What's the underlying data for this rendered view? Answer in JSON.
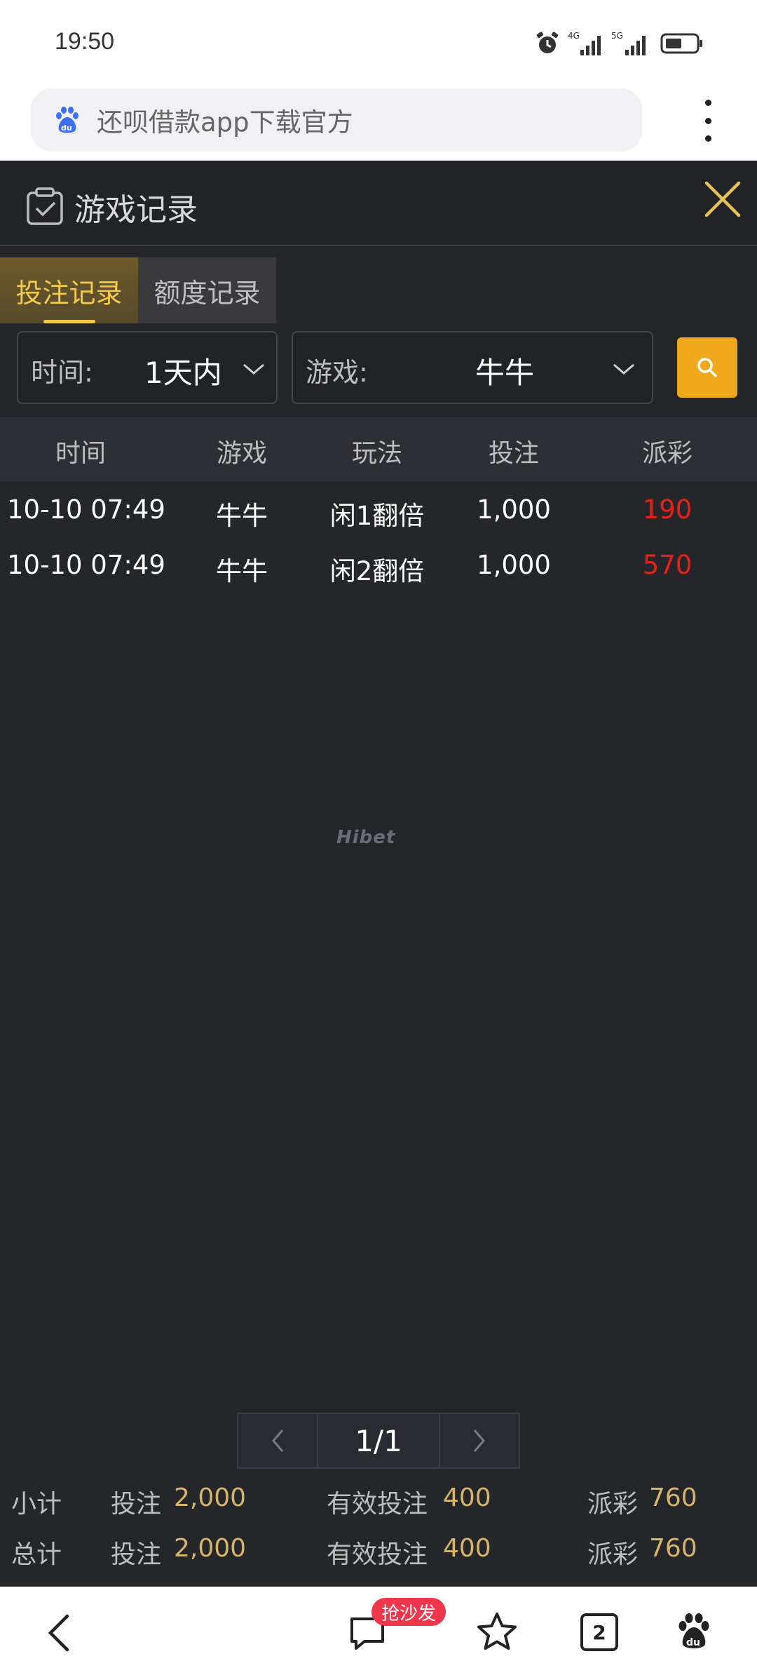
{
  "status_bar": {
    "time": "19:50",
    "net1": "4G",
    "net2": "5G"
  },
  "browser": {
    "url_text": "还呗借款app下载官方",
    "tab_count": "2",
    "sofa_badge": "抢沙发"
  },
  "dialog": {
    "title": "游戏记录"
  },
  "tabs": [
    {
      "label": "投注记录",
      "active": true
    },
    {
      "label": "额度记录",
      "active": false
    }
  ],
  "filters": {
    "time_label": "时间:",
    "time_value": "1天内",
    "game_label": "游戏:",
    "game_value": "牛牛"
  },
  "table": {
    "headers": [
      "时间",
      "游戏",
      "玩法",
      "投注",
      "派彩"
    ],
    "rows": [
      {
        "time": "10-10 07:49",
        "game": "牛牛",
        "play": "闲1翻倍",
        "bet": "1,000",
        "payout": "190"
      },
      {
        "time": "10-10 07:49",
        "game": "牛牛",
        "play": "闲2翻倍",
        "bet": "1,000",
        "payout": "570"
      }
    ]
  },
  "watermark": "Hibet",
  "pager": {
    "info": "1/1"
  },
  "summary": {
    "subtotal": {
      "label": "小计",
      "bet_label": "投注",
      "bet": "2,000",
      "valid_label": "有效投注",
      "valid": "400",
      "payout_label": "派彩",
      "payout": "760"
    },
    "total": {
      "label": "总计",
      "bet_label": "投注",
      "bet": "2,000",
      "valid_label": "有效投注",
      "valid": "400",
      "payout_label": "派彩",
      "payout": "760"
    }
  },
  "colors": {
    "accent": "#f2c94c",
    "search_bg": "#f0a81d",
    "payout_red": "#e62117",
    "panel_bg": "#25262a"
  },
  "icons": [
    "alarm-icon",
    "signal-icon",
    "battery-icon",
    "baidu-logo-icon",
    "more-vert-icon",
    "checklist-icon",
    "close-icon",
    "chevron-down-icon",
    "search-icon",
    "chevron-left-icon",
    "chevron-right-icon",
    "back-icon",
    "comment-icon",
    "star-icon",
    "tabs-icon",
    "baidu-paw-icon"
  ]
}
